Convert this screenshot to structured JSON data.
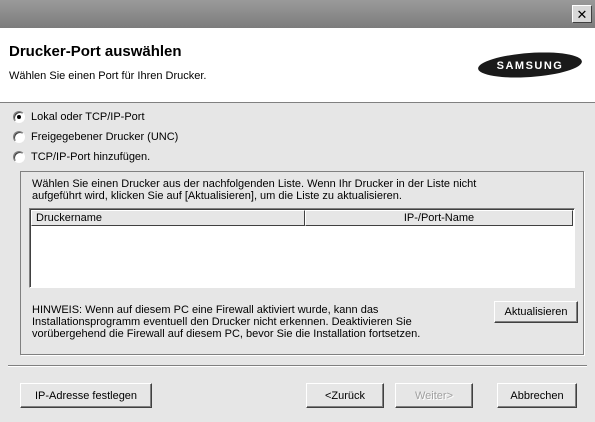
{
  "window": {
    "close_label": "✕"
  },
  "header": {
    "title": "Drucker-Port auswählen",
    "subtitle": "Wählen Sie einen Port für Ihren Drucker.",
    "logo_text": "SAMSUNG"
  },
  "options": [
    {
      "label": "Lokal oder TCP/IP-Port",
      "checked": true
    },
    {
      "label": "Freigegebener Drucker (UNC)",
      "checked": false
    },
    {
      "label": "TCP/IP-Port hinzufügen.",
      "checked": false
    }
  ],
  "group": {
    "description_line1": "Wählen Sie einen Drucker aus der nachfolgenden Liste. Wenn Ihr Drucker in der Liste nicht",
    "description_line2": "aufgeführt wird, klicken Sie auf [Aktualisieren], um die Liste zu aktualisieren.",
    "columns": [
      "Druckername",
      "IP-/Port-Name"
    ],
    "rows": [],
    "note_line1": "HINWEIS: Wenn auf diesem PC eine Firewall aktiviert wurde, kann das",
    "note_line2": "Installationsprogramm eventuell den Drucker nicht erkennen. Deaktivieren Sie",
    "note_line3": "vorübergehend die Firewall auf diesem PC, bevor Sie die Installation fortsetzen.",
    "refresh_label": "Aktualisieren"
  },
  "footer": {
    "set_ip_label": "IP-Adresse festlegen",
    "back_label": "<Zurück",
    "next_label": "Weiter>",
    "cancel_label": "Abbrechen"
  },
  "colors": {
    "titlebar": "#8a8a8a",
    "dialog_bg": "#e6e6e6",
    "header_bg": "#ffffff"
  }
}
